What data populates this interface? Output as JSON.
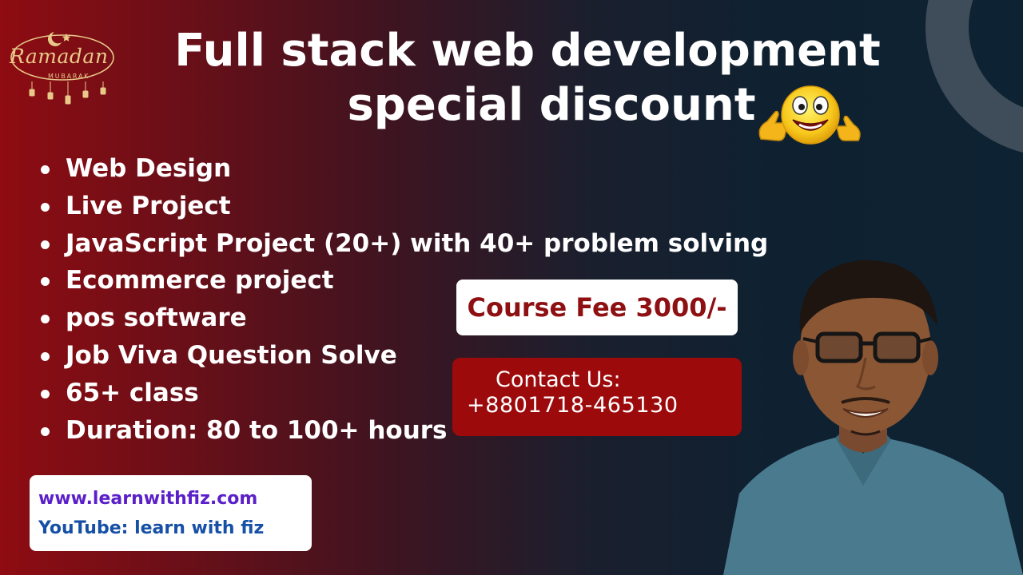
{
  "badge": {
    "script_text": "Ramadan",
    "sub_text": "MUBARAK"
  },
  "headline": {
    "line1": "Full stack web development",
    "line2": "special discount"
  },
  "features": [
    "Web Design",
    "Live Project",
    "JavaScript Project (20+) with 40+ problem solving",
    "Ecommerce project",
    "pos software",
    "Job Viva Question Solve",
    "65+ class",
    "Duration: 80 to 100+ hours"
  ],
  "fee": {
    "label": "Course Fee 3000/-"
  },
  "contact": {
    "label": "Contact Us:",
    "phone": "+8801718-465130"
  },
  "links": {
    "website": "www.learnwithfiz.com",
    "youtube": "YouTube: learn with fiz"
  },
  "icons": {
    "emoji": "thumbs-up-smiley-icon",
    "badge": "crescent-moon-lanterns-icon",
    "photo": "instructor-photo"
  },
  "colors": {
    "background_left": "#8e0c12",
    "background_right": "#0d2232",
    "fee_text": "#8e1012",
    "contact_bg": "#9c0a0c",
    "website_text": "#5a1fc9",
    "youtube_text": "#1650a6",
    "gold": "#e8c98a"
  }
}
